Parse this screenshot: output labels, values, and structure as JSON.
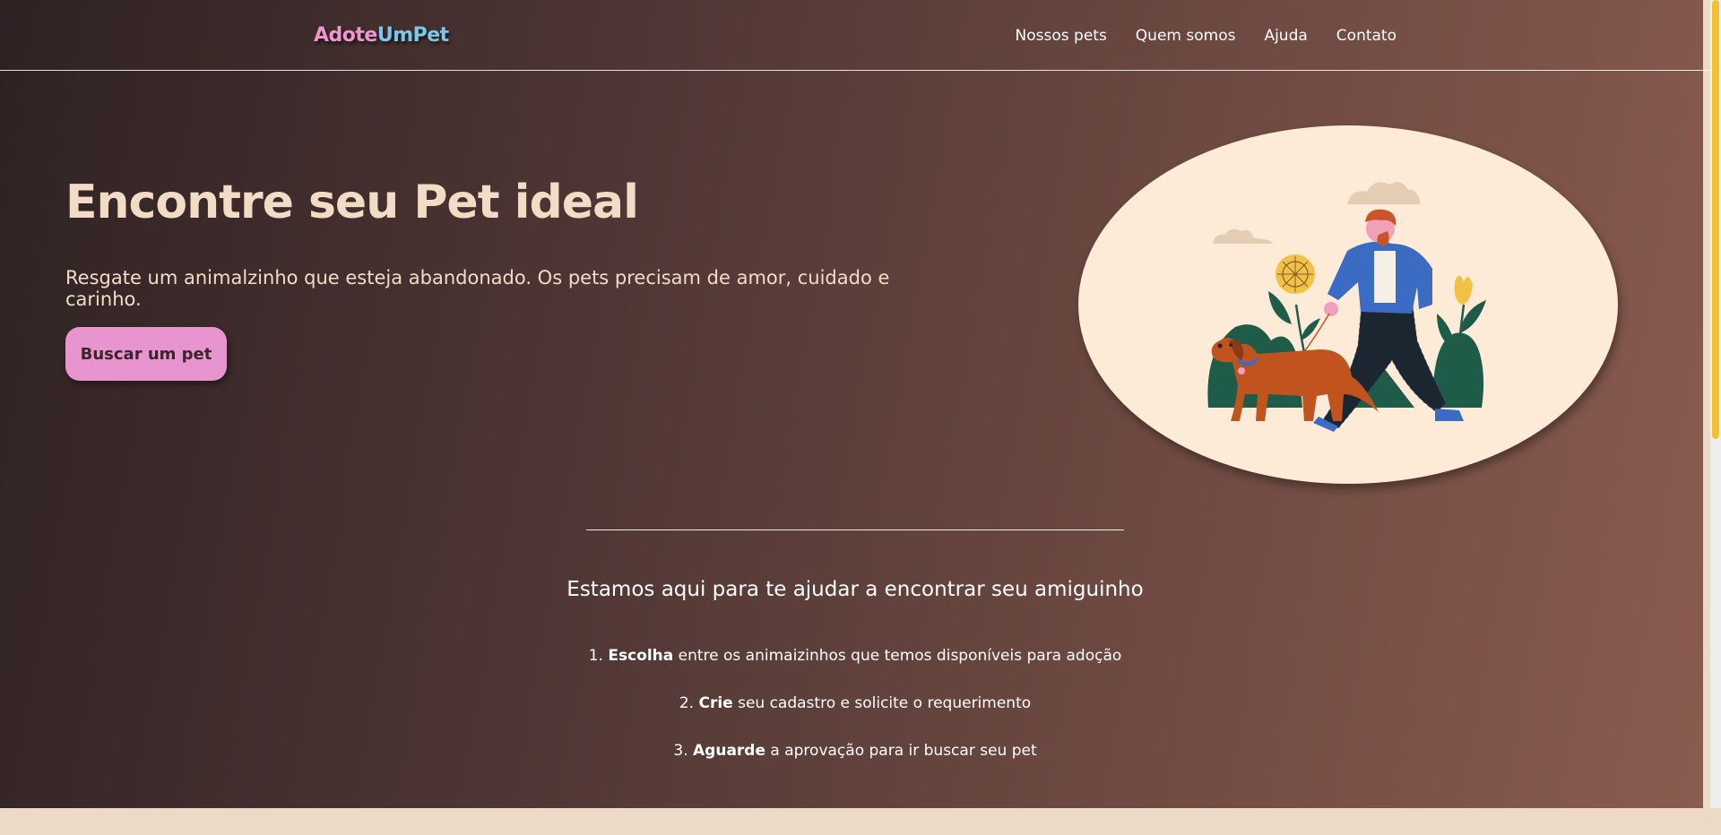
{
  "header": {
    "logo_part1": "Adote",
    "logo_part2": "UmPet",
    "nav": [
      "Nossos pets",
      "Quem somos",
      "Ajuda",
      "Contato"
    ]
  },
  "hero": {
    "title": "Encontre seu Pet ideal",
    "subtitle": "Resgate um animalzinho que esteja abandonado. Os pets precisam de amor, cuidado e carinho.",
    "cta_label": "Buscar um pet",
    "illustration": "person-walking-dog-illustration"
  },
  "steps": {
    "title": "Estamos aqui para te ajudar a encontrar seu amiguinho",
    "items": [
      {
        "num": "1.",
        "strong": "Escolha",
        "rest": " entre os animaizinhos que temos disponíveis para adoção"
      },
      {
        "num": "2.",
        "strong": "Crie",
        "rest": " seu cadastro e solicite o requerimento"
      },
      {
        "num": "3.",
        "strong": "Aguarde",
        "rest": " a aprovação para ir buscar seu pet"
      }
    ]
  },
  "colors": {
    "logo_pink": "#ee97cf",
    "logo_blue": "#7cc7e8",
    "cta_background": "#e794cf",
    "hero_text": "#f3dcc6",
    "scrollbar_thumb": "#f2c12e"
  }
}
